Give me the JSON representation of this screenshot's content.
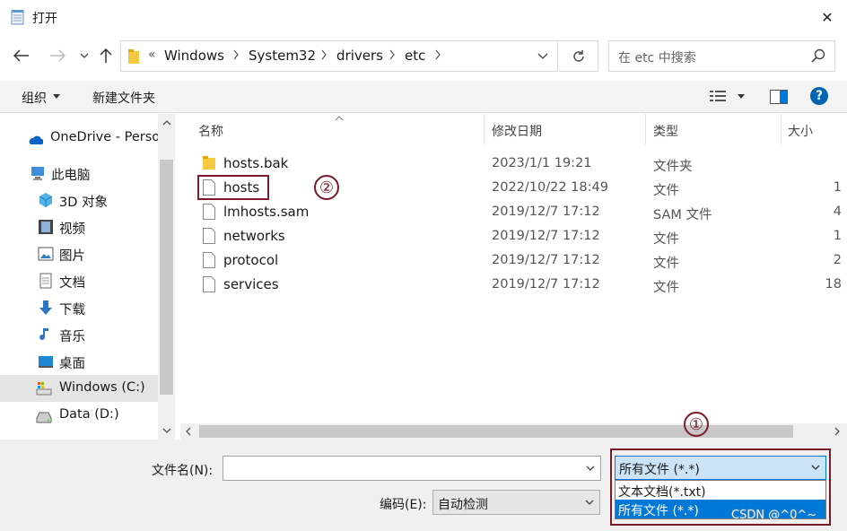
{
  "window": {
    "title": "打开",
    "close_glyph": "✕"
  },
  "nav": {
    "breadcrumb": [
      "Windows",
      "System32",
      "drivers",
      "etc"
    ],
    "overflow": "«",
    "search_placeholder": "在 etc 中搜索"
  },
  "toolbar": {
    "organize": "组织",
    "new_folder": "新建文件夹",
    "help": "?"
  },
  "sidebar": {
    "items": [
      {
        "label": "OneDrive - Perso",
        "icon": "onedrive-icon"
      },
      {
        "label": "此电脑",
        "icon": "pc-icon"
      },
      {
        "label": "3D 对象",
        "icon": "3d-objects-icon"
      },
      {
        "label": "视频",
        "icon": "video-icon"
      },
      {
        "label": "图片",
        "icon": "pictures-icon"
      },
      {
        "label": "文档",
        "icon": "documents-icon"
      },
      {
        "label": "下载",
        "icon": "downloads-icon"
      },
      {
        "label": "音乐",
        "icon": "music-icon"
      },
      {
        "label": "桌面",
        "icon": "desktop-icon"
      },
      {
        "label": "Windows (C:)",
        "icon": "drive-c-icon",
        "selected": true
      },
      {
        "label": "Data (D:)",
        "icon": "drive-d-icon"
      }
    ]
  },
  "columns": {
    "name": "名称",
    "date": "修改日期",
    "type": "类型",
    "size": "大小"
  },
  "files": [
    {
      "name": "hosts.bak",
      "date": "2023/1/1 19:21",
      "type": "文件夹",
      "size": "",
      "kind": "folder"
    },
    {
      "name": "hosts",
      "date": "2022/10/22 18:49",
      "type": "文件",
      "size": "1",
      "kind": "file",
      "highlight": true
    },
    {
      "name": "lmhosts.sam",
      "date": "2019/12/7 17:12",
      "type": "SAM 文件",
      "size": "4",
      "kind": "file"
    },
    {
      "name": "networks",
      "date": "2019/12/7 17:12",
      "type": "文件",
      "size": "1",
      "kind": "file"
    },
    {
      "name": "protocol",
      "date": "2019/12/7 17:12",
      "type": "文件",
      "size": "2",
      "kind": "file"
    },
    {
      "name": "services",
      "date": "2019/12/7 17:12",
      "type": "文件",
      "size": "18",
      "kind": "file"
    }
  ],
  "bottom": {
    "filename_label": "文件名(N):",
    "filename_value": "",
    "encoding_label": "编码(E):",
    "encoding_value": "自动检测",
    "filter_selected": "所有文件  (*.*)",
    "filter_options": [
      "文本文档(*.txt)",
      "所有文件  (*.*)"
    ]
  },
  "annotations": {
    "one": "①",
    "two": "②"
  },
  "watermark": "CSDN @^0^~",
  "colors": {
    "accent": "#0078d7",
    "annotation": "#7a1a2a",
    "selected_option": "#0078d7"
  }
}
